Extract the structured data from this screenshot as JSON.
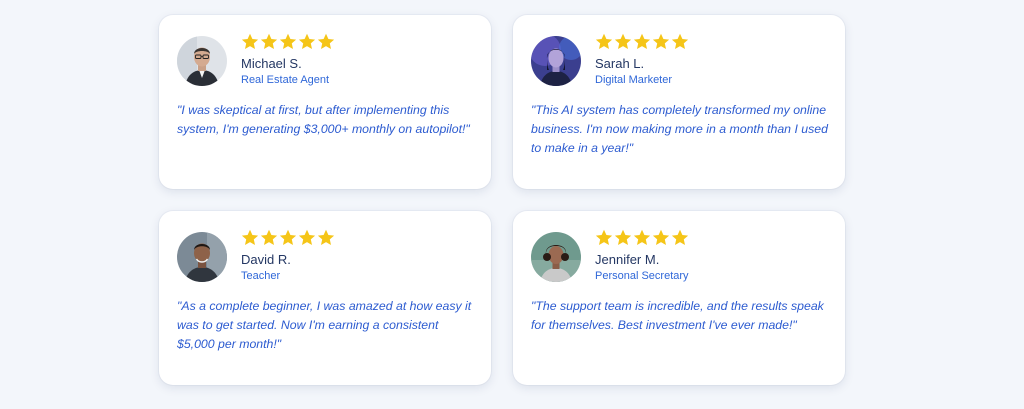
{
  "colors": {
    "page_background": "#f3f6fb",
    "star": "#f5c518",
    "name": "#243763",
    "role": "#2f67d8",
    "quote": "#2c5bd0"
  },
  "testimonials": [
    {
      "avatar_icon": "person-photo-icon",
      "rating": 5,
      "name": "Michael S.",
      "role": "Real Estate Agent",
      "quote": "\"I was skeptical at first, but after implementing this system, I'm generating $3,000+ monthly on autopilot!\""
    },
    {
      "avatar_icon": "person-photo-icon",
      "rating": 5,
      "name": "Sarah L.",
      "role": "Digital Marketer",
      "quote": "\"This AI system has completely transformed my online business. I'm now making more in a month than I used to make in a year!\""
    },
    {
      "avatar_icon": "person-photo-icon",
      "rating": 5,
      "name": "David R.",
      "role": "Teacher",
      "quote": "\"As a complete beginner, I was amazed at how easy it was to get started. Now I'm earning a consistent $5,000 per month!\""
    },
    {
      "avatar_icon": "person-photo-icon",
      "rating": 5,
      "name": "Jennifer M.",
      "role": "Personal Secretary",
      "quote": "\"The support team is incredible, and the results speak for themselves. Best investment I've ever made!\""
    }
  ]
}
